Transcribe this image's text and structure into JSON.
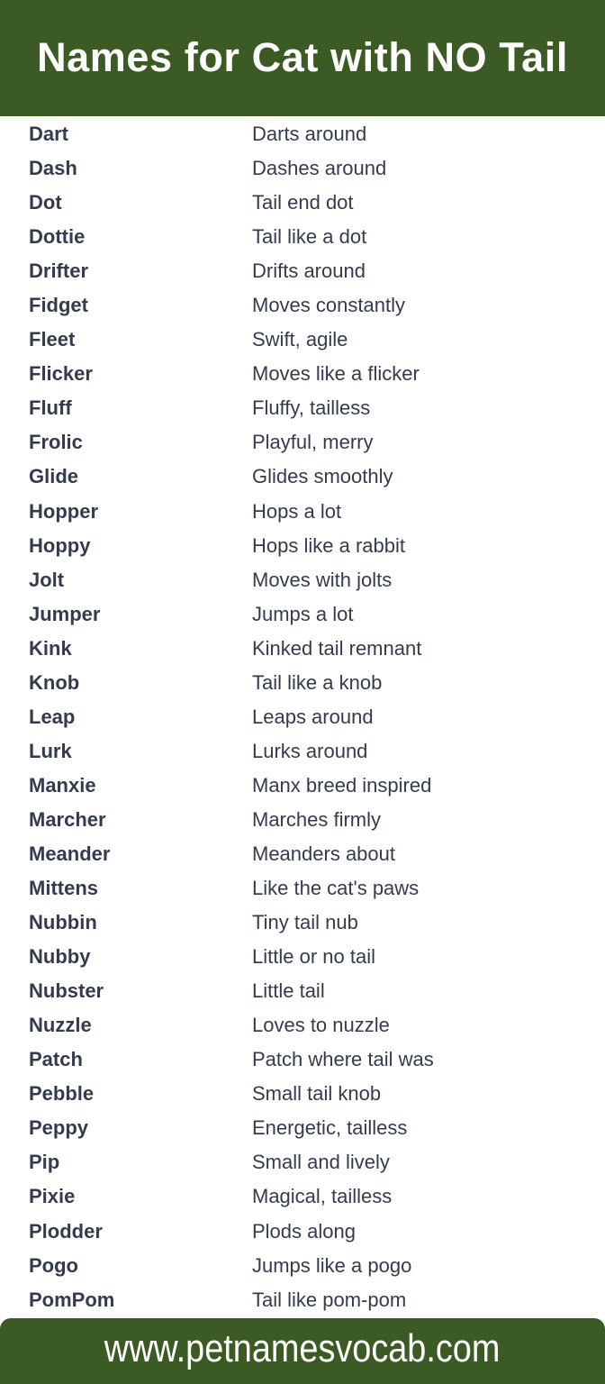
{
  "header": {
    "title": "Names for Cat with NO Tail"
  },
  "rows": [
    {
      "name": "Dart",
      "desc": "Darts around"
    },
    {
      "name": "Dash",
      "desc": "Dashes around"
    },
    {
      "name": "Dot",
      "desc": "Tail end dot"
    },
    {
      "name": "Dottie",
      "desc": "Tail like a dot"
    },
    {
      "name": "Drifter",
      "desc": "Drifts around"
    },
    {
      "name": "Fidget",
      "desc": "Moves constantly"
    },
    {
      "name": "Fleet",
      "desc": "Swift, agile"
    },
    {
      "name": "Flicker",
      "desc": "Moves like a flicker"
    },
    {
      "name": "Fluff",
      "desc": "Fluffy, tailless"
    },
    {
      "name": "Frolic",
      "desc": "Playful, merry"
    },
    {
      "name": "Glide",
      "desc": "Glides smoothly"
    },
    {
      "name": "Hopper",
      "desc": "Hops a lot"
    },
    {
      "name": "Hoppy",
      "desc": "Hops like a rabbit"
    },
    {
      "name": "Jolt",
      "desc": "Moves with jolts"
    },
    {
      "name": "Jumper",
      "desc": "Jumps a lot"
    },
    {
      "name": "Kink",
      "desc": "Kinked tail remnant"
    },
    {
      "name": "Knob",
      "desc": "Tail like a knob"
    },
    {
      "name": "Leap",
      "desc": "Leaps around"
    },
    {
      "name": "Lurk",
      "desc": "Lurks around"
    },
    {
      "name": "Manxie",
      "desc": "Manx breed inspired"
    },
    {
      "name": "Marcher",
      "desc": "Marches firmly"
    },
    {
      "name": "Meander",
      "desc": "Meanders about"
    },
    {
      "name": "Mittens",
      "desc": "Like the cat's paws"
    },
    {
      "name": "Nubbin",
      "desc": "Tiny tail nub"
    },
    {
      "name": "Nubby",
      "desc": "Little or no tail"
    },
    {
      "name": "Nubster",
      "desc": "Little tail"
    },
    {
      "name": "Nuzzle",
      "desc": "Loves to nuzzle"
    },
    {
      "name": "Patch",
      "desc": "Patch where tail was"
    },
    {
      "name": "Pebble",
      "desc": "Small tail knob"
    },
    {
      "name": "Peppy",
      "desc": "Energetic, tailless"
    },
    {
      "name": "Pip",
      "desc": "Small and lively"
    },
    {
      "name": "Pixie",
      "desc": "Magical, tailless"
    },
    {
      "name": "Plodder",
      "desc": "Plods along"
    },
    {
      "name": "Pogo",
      "desc": "Jumps like a pogo"
    },
    {
      "name": "PomPom",
      "desc": "Tail like pom-pom"
    }
  ],
  "footer": {
    "url": "www.petnamesvocab.com"
  },
  "colors": {
    "brand_green": "#3b5a24",
    "text": "#333c4e"
  }
}
